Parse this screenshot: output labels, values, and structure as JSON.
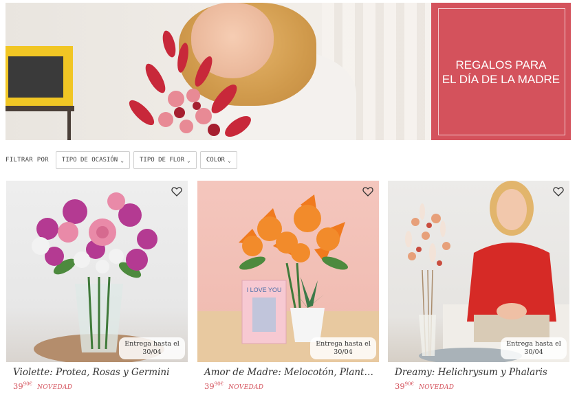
{
  "hero": {
    "promo_line1": "REGALOS PARA",
    "promo_line2": "EL DÍA DE LA MADRE",
    "colors": {
      "promo_bg": "#d4525c",
      "frame": "#f1c624"
    }
  },
  "filters": {
    "label": "FILTRAR POR",
    "buttons": [
      {
        "label": "TIPO DE OCASIÓN"
      },
      {
        "label": "TIPO DE FLOR"
      },
      {
        "label": "COLOR"
      }
    ],
    "chevron_icon": "chevron-down-icon"
  },
  "products": [
    {
      "title": "Violette: Protea, Rosas y Germini",
      "price_main": "39",
      "price_sup": "90€",
      "badge": "NOVEDAD",
      "delivery_line1": "Entrega hasta el",
      "delivery_line2": "30/04"
    },
    {
      "title": "Amor de Madre: Melocotón, Planta ...",
      "price_main": "39",
      "price_sup": "90€",
      "badge": "NOVEDAD",
      "delivery_line1": "Entrega hasta el",
      "delivery_line2": "30/04",
      "card_text": "I LOVE YOU"
    },
    {
      "title": "Dreamy: Helichrysum y Phalaris",
      "price_main": "39",
      "price_sup": "90€",
      "badge": "NOVEDAD",
      "delivery_line1": "Entrega hasta el",
      "delivery_line2": "30/04"
    }
  ],
  "icons": {
    "favorite": "heart-icon"
  },
  "colors": {
    "accent": "#d4525c"
  }
}
